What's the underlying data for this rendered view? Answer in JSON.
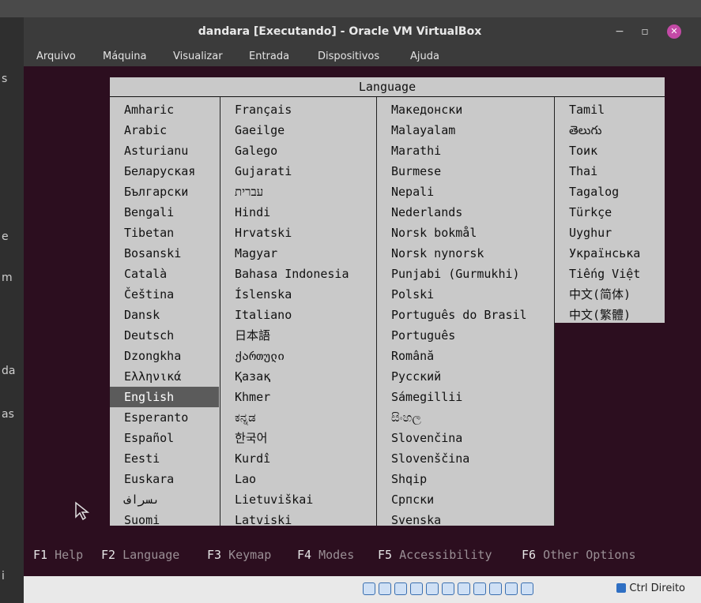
{
  "window": {
    "title": "dandara [Executando] - Oracle VM VirtualBox"
  },
  "menubar": [
    "Arquivo",
    "Máquina",
    "Visualizar",
    "Entrada",
    "Dispositivos",
    "Ajuda"
  ],
  "language_menu": {
    "header": "Language",
    "selected": "English",
    "columns": [
      [
        "Amharic",
        "Arabic",
        "Asturianu",
        "Беларуская",
        "Български",
        "Bengali",
        "Tibetan",
        "Bosanski",
        "Català",
        "Čeština",
        "Dansk",
        "Deutsch",
        "Dzongkha",
        "Ελληνικά",
        "English",
        "Esperanto",
        "Español",
        "Eesti",
        "Euskara",
        "ىسراف",
        "Suomi"
      ],
      [
        "Français",
        "Gaeilge",
        "Galego",
        "Gujarati",
        "עברית",
        "Hindi",
        "Hrvatski",
        "Magyar",
        "Bahasa Indonesia",
        "Íslenska",
        "Italiano",
        "日本語",
        "ქართული",
        "Қазақ",
        "Khmer",
        "ಕನ್ನಡ",
        "한국어",
        "Kurdî",
        "Lao",
        "Lietuviškai",
        "Latviski"
      ],
      [
        "Македонски",
        "Malayalam",
        "Marathi",
        "Burmese",
        "Nepali",
        "Nederlands",
        "Norsk bokmål",
        "Norsk nynorsk",
        "Punjabi (Gurmukhi)",
        "Polski",
        "Português do Brasil",
        "Português",
        "Română",
        "Русский",
        "Sámegillii",
        "සිංහල",
        "Slovenčina",
        "Slovenščina",
        "Shqip",
        "Српски",
        "Svenska"
      ],
      [
        "Tamil",
        "తెలుగు",
        "Тоик",
        "Thai",
        "Tagalog",
        "Türkçe",
        "Uyghur",
        "Українська",
        "Tiếng Việt",
        "中文(简体)",
        "中文(繁體)"
      ]
    ]
  },
  "function_keys": [
    {
      "key": "F1",
      "label": "Help"
    },
    {
      "key": "F2",
      "label": "Language"
    },
    {
      "key": "F3",
      "label": "Keymap"
    },
    {
      "key": "F4",
      "label": "Modes"
    },
    {
      "key": "F5",
      "label": "Accessibility"
    },
    {
      "key": "F6",
      "label": "Other Options"
    }
  ],
  "statusbar": {
    "host_key": "Ctrl Direito",
    "icons": [
      "hdd-icon",
      "optical-icon",
      "audio-icon",
      "network-icon",
      "usb-icon",
      "shared-folder-icon",
      "display-icon",
      "video-capture-icon",
      "cpu-icon",
      "mouse-integration-icon",
      "keyboard-icon"
    ]
  },
  "desktop_left_text": [
    "s",
    "e",
    "m",
    "da",
    "as",
    "i"
  ]
}
